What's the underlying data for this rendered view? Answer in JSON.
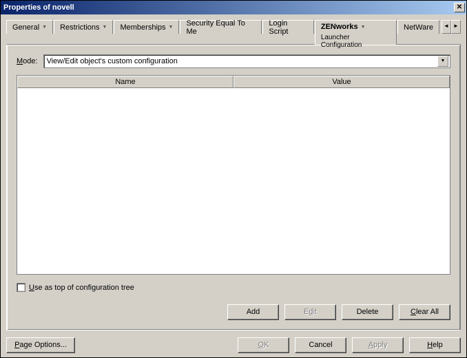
{
  "title": "Properties of novell",
  "tabs": {
    "general": "General",
    "restrictions": "Restrictions",
    "memberships": "Memberships",
    "securityEqual": "Security Equal To Me",
    "loginScript": "Login Script",
    "zenworks": "ZENworks",
    "zenworksSub": "Launcher Configuration",
    "netware": "NetWare"
  },
  "mode": {
    "label_pre": "M",
    "label_post": "ode:",
    "value": "View/Edit object's custom configuration"
  },
  "table": {
    "name": "Name",
    "value": "Value"
  },
  "checkbox": {
    "pre": "U",
    "post": "se as top of configuration tree"
  },
  "buttons": {
    "add": "Add",
    "edit_pre": "E",
    "edit_mid": "d",
    "edit_post": "it",
    "delete": "Delete",
    "clearAll_pre": "C",
    "clearAll_post": "lear All"
  },
  "bottom": {
    "pageOptions_pre": "P",
    "pageOptions_post": "age Options...",
    "ok_pre": "O",
    "ok_post": "K",
    "cancel": "Cancel",
    "apply_pre": "A",
    "apply_post": "pply",
    "help_pre": "H",
    "help_post": "elp"
  }
}
